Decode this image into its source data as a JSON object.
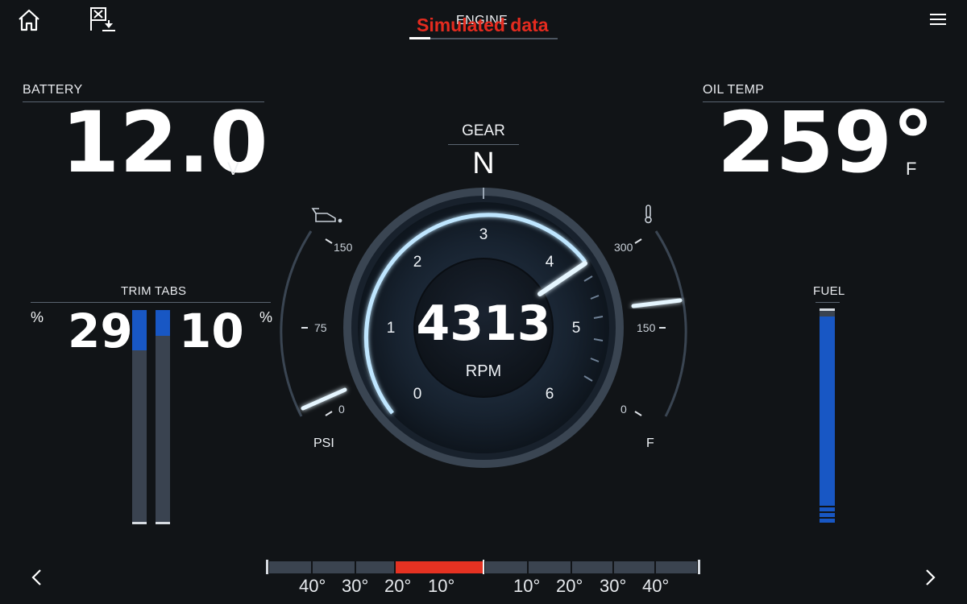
{
  "header": {
    "page_title": "ENGINE",
    "simulated_label": "Simulated data"
  },
  "battery": {
    "label": "BATTERY",
    "value": "12.0",
    "unit": "V"
  },
  "oil_temp": {
    "label": "OIL TEMP",
    "value": "259°",
    "unit": "F"
  },
  "gear": {
    "label": "GEAR",
    "value": "N"
  },
  "rpm": {
    "value": "4313",
    "unit": "RPM",
    "scale": [
      "0",
      "1",
      "2",
      "3",
      "4",
      "5",
      "6"
    ]
  },
  "oil_pressure": {
    "unit": "PSI",
    "ticks": [
      "150",
      "75",
      "0"
    ],
    "level": 0.02
  },
  "temperature_gauge": {
    "unit": "F",
    "ticks": [
      "300",
      "150",
      "0"
    ],
    "level": 0.58
  },
  "trim_tabs": {
    "label": "TRIM TABS",
    "left_unit": "%",
    "left_value": "29",
    "right_value": "10",
    "right_unit": "%",
    "left_level": 0.19,
    "right_level": 0.12
  },
  "fuel": {
    "label": "FUEL",
    "level": 0.97
  },
  "rudder": {
    "left_labels": [
      "40°",
      "30°",
      "20°",
      "10°"
    ],
    "right_labels": [
      "10°",
      "20°",
      "30°",
      "40°"
    ]
  },
  "colors": {
    "accent_blue": "#1857c4",
    "alert_red": "#e53222",
    "glow": "#bfe6ff",
    "background": "#111417"
  },
  "icons": {
    "home": "home-icon",
    "waypoint": "waypoint-flag-icon",
    "menu": "menu-icon",
    "prev": "chevron-left-icon",
    "next": "chevron-right-icon",
    "oil": "oil-can-icon",
    "thermometer": "thermometer-icon"
  }
}
